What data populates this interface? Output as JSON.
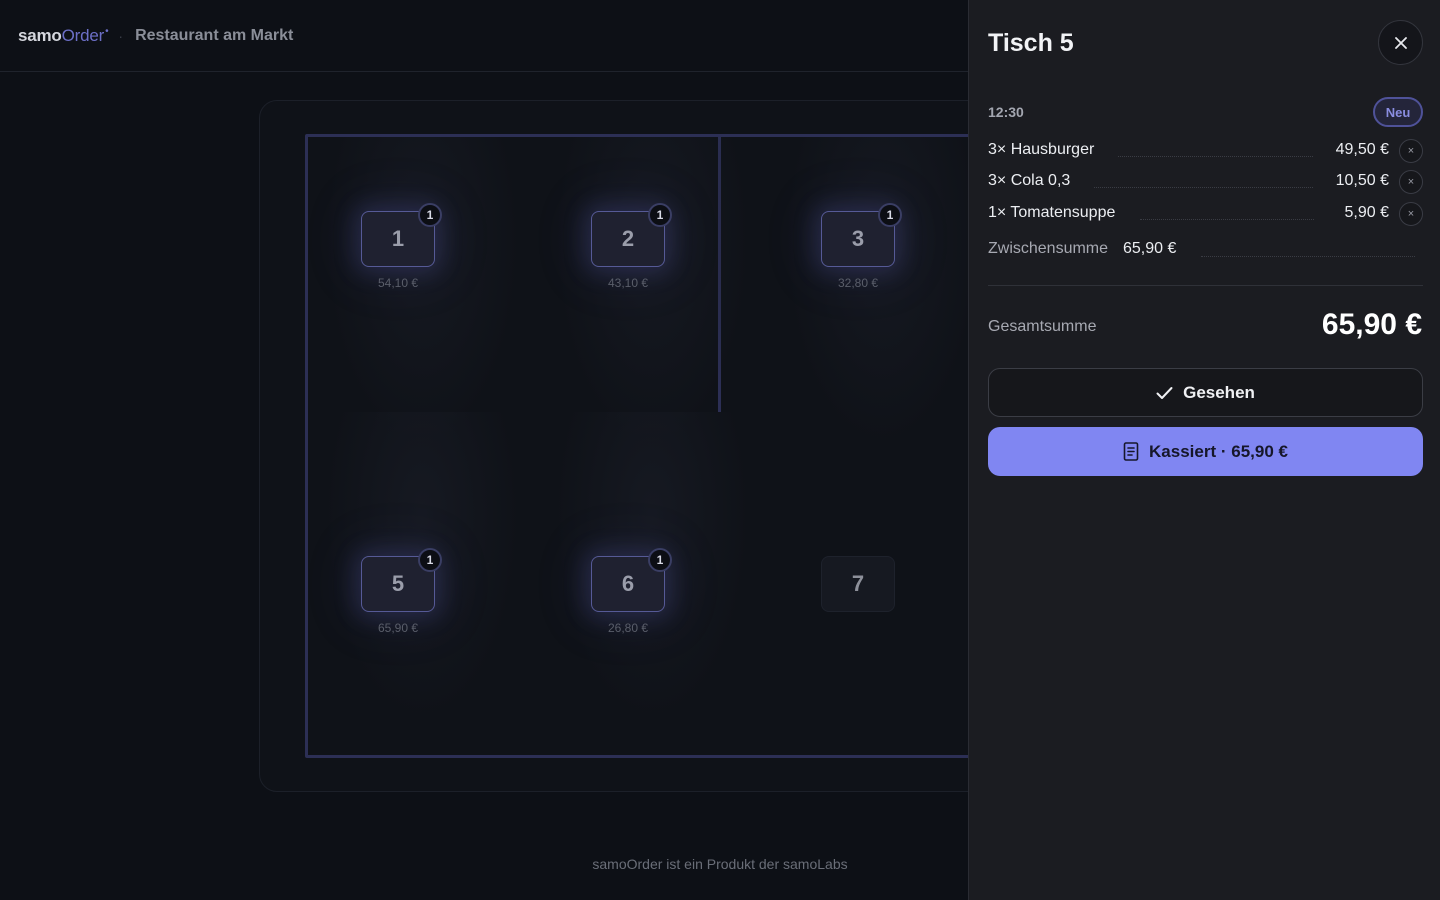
{
  "header": {
    "logo_primary": "samo",
    "logo_secondary": "Order",
    "logo_mark": "•",
    "separator": "·",
    "restaurant_name": "Restaurant am Markt"
  },
  "floor": {
    "tables": [
      {
        "number": "1",
        "badge": "1",
        "amount": "54,10 €",
        "active": true
      },
      {
        "number": "2",
        "badge": "1",
        "amount": "43,10 €",
        "active": true
      },
      {
        "number": "3",
        "badge": "1",
        "amount": "32,80 €",
        "active": true
      },
      {
        "number": "5",
        "badge": "1",
        "amount": "65,90 €",
        "active": true
      },
      {
        "number": "6",
        "badge": "1",
        "amount": "26,80 €",
        "active": true
      },
      {
        "number": "7",
        "badge": "",
        "amount": "",
        "active": false
      }
    ]
  },
  "footer": {
    "text": "samoOrder ist ein Produkt der samoLabs"
  },
  "panel": {
    "title": "Tisch 5",
    "close_icon": "close-icon",
    "order": {
      "time": "12:30",
      "status_badge": "Neu",
      "items": [
        {
          "name": "3× Hausburger",
          "price": "49,50 €",
          "remove_label": "×"
        },
        {
          "name": "3× Cola 0,3",
          "price": "10,50 €",
          "remove_label": "×"
        },
        {
          "name": "1× Tomatensuppe",
          "price": "5,90 €",
          "remove_label": "×"
        }
      ],
      "subtotal_label": "Zwischensumme",
      "subtotal_value": "65,90 €"
    },
    "total_label": "Gesamtsumme",
    "total_value": "65,90 €",
    "seen_button": {
      "label": "Gesehen",
      "icon": "check-icon"
    },
    "paid_button": {
      "label": "Kassiert · 65,90 €",
      "icon": "receipt-icon"
    }
  },
  "colors": {
    "accent": "#8086f2",
    "background": "#0d1016",
    "panel": "#1b1c21",
    "room_wall": "#2c2f55"
  }
}
